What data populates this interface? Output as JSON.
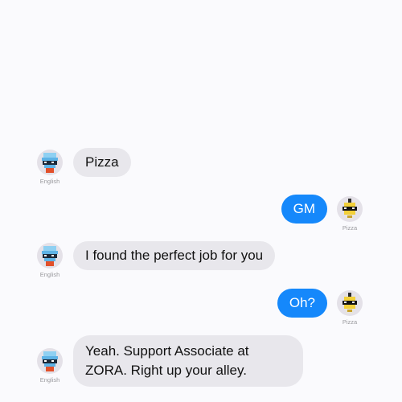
{
  "participants": {
    "english": {
      "name": "English",
      "accent": "#5eb3e6",
      "glasses": "#1c2a3a",
      "shirt": "#e2502a"
    },
    "pizza": {
      "name": "Pizza",
      "accent": "#f2d03a",
      "glasses": "#111111",
      "hat": "#2b2b2b"
    }
  },
  "colors": {
    "incoming_bubble": "#e8e7ec",
    "outgoing_bubble": "#1588fb",
    "background": "#fafafd"
  },
  "messages": [
    {
      "sender": "English",
      "direction": "incoming",
      "text": "Pizza"
    },
    {
      "sender": "Pizza",
      "direction": "outgoing",
      "text": "GM"
    },
    {
      "sender": "English",
      "direction": "incoming",
      "text": "I found the perfect job for you"
    },
    {
      "sender": "Pizza",
      "direction": "outgoing",
      "text": "Oh?"
    },
    {
      "sender": "English",
      "direction": "incoming",
      "text": "Yeah. Support Associate at ZORA. Right up your alley."
    }
  ]
}
